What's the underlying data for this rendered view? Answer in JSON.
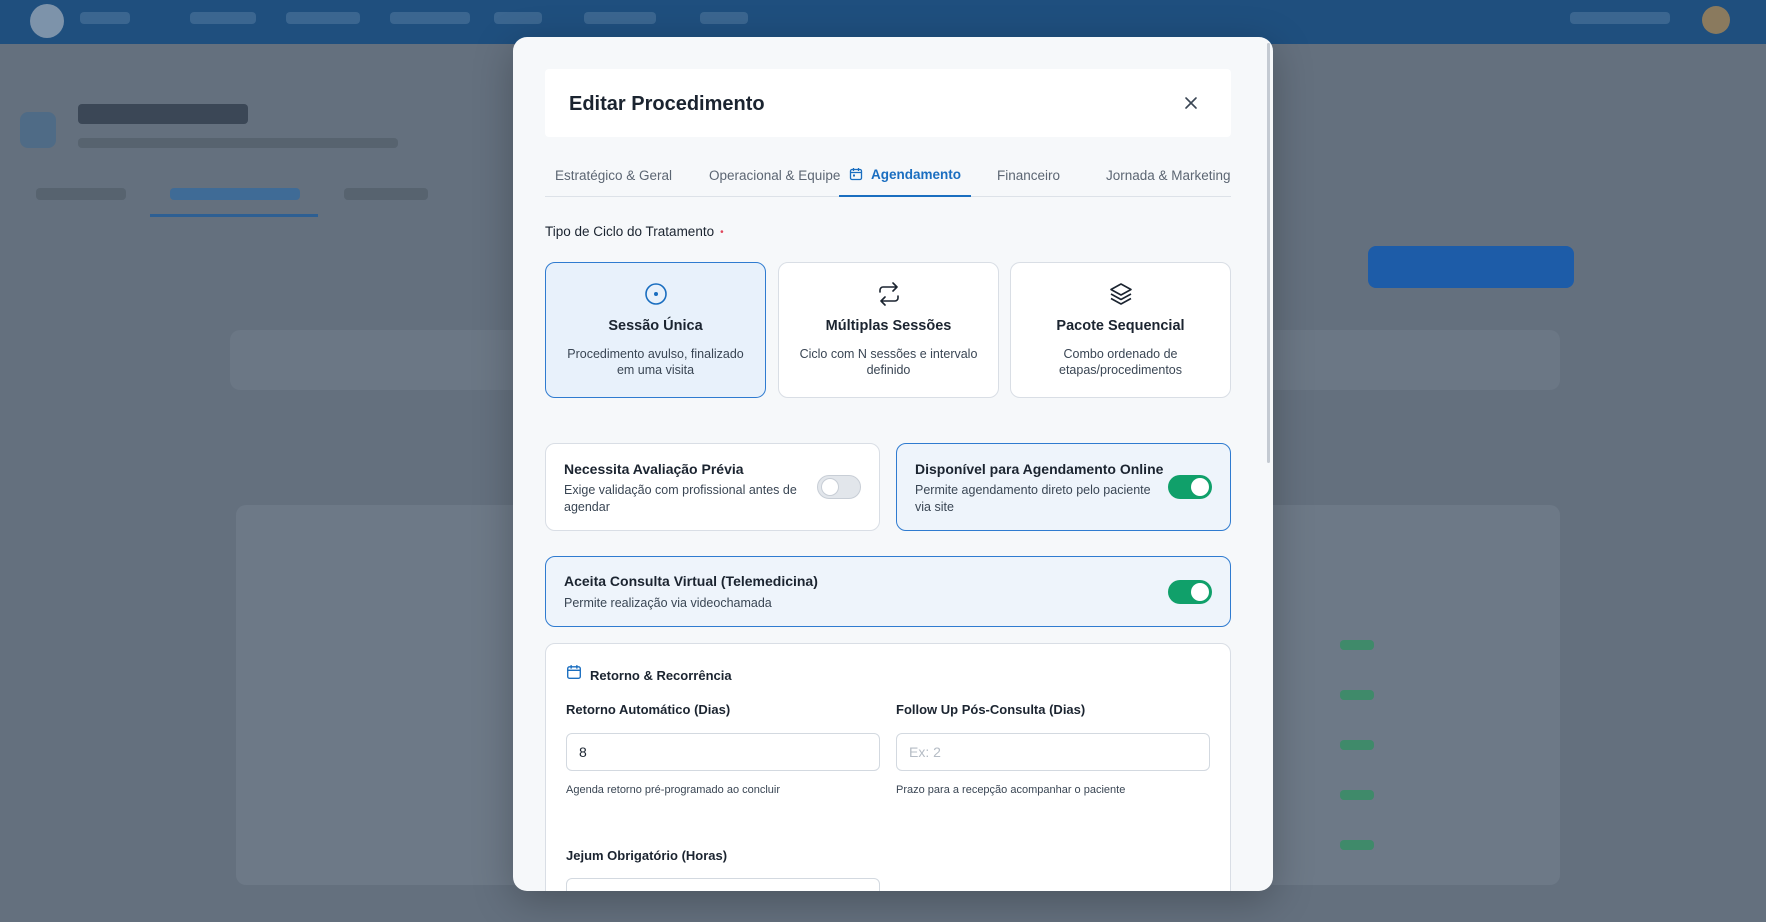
{
  "modal": {
    "title": "Editar Procedimento"
  },
  "tabs": [
    {
      "label": "Estratégico & Geral"
    },
    {
      "label": "Operacional & Equipe"
    },
    {
      "label": "Agendamento"
    },
    {
      "label": "Financeiro"
    },
    {
      "label": "Jornada & Marketing"
    }
  ],
  "cycle": {
    "label": "Tipo de Ciclo do Tratamento",
    "required_mark": "•",
    "options": [
      {
        "title": "Sessão Única",
        "description": "Procedimento avulso, finalizado em uma visita",
        "icon": "target-icon",
        "selected": true
      },
      {
        "title": "Múltiplas Sessões",
        "description": "Ciclo com N sessões e intervalo definido",
        "icon": "repeat-icon",
        "selected": false
      },
      {
        "title": "Pacote Sequencial",
        "description": "Combo ordenado de etapas/procedimentos",
        "icon": "layers-icon",
        "selected": false
      }
    ]
  },
  "options": {
    "evaluation": {
      "title": "Necessita Avaliação Prévia",
      "description": "Exige validação com profissional antes de agendar",
      "enabled": false
    },
    "online": {
      "title": "Disponível para Agendamento Online",
      "description": "Permite agendamento direto pelo paciente via site",
      "enabled": true
    },
    "telemedicine": {
      "title": "Aceita Consulta Virtual (Telemedicina)",
      "description": "Permite realização via videochamada",
      "enabled": true
    }
  },
  "return_section": {
    "title": "Retorno & Recorrência",
    "auto_return": {
      "label": "Retorno Automático (Dias)",
      "value": "8",
      "help": "Agenda retorno pré-programado ao concluir"
    },
    "follow_up": {
      "label": "Follow Up Pós-Consulta (Dias)",
      "value": "",
      "placeholder": "Ex: 2",
      "help": "Prazo para a recepção acompanhar o paciente"
    },
    "fasting": {
      "label": "Jejum Obrigatório (Horas)"
    }
  },
  "colors": {
    "accent": "#1a6ec0",
    "toggle_on": "#10a06a",
    "required": "#e0465b"
  }
}
